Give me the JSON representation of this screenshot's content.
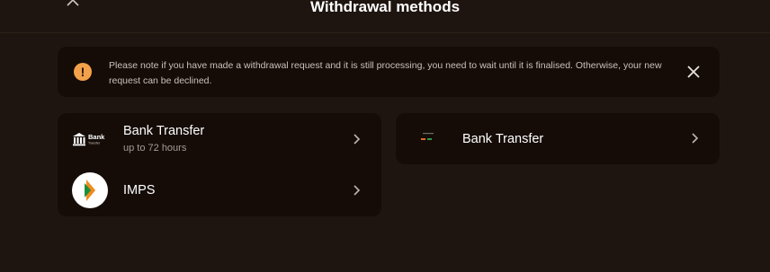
{
  "header": {
    "title": "Withdrawal methods"
  },
  "notice": {
    "text": "Please note if you have made a withdrawal request and it is still processing, you need to wait until it is finalised. Otherwise, your new request can be declined.",
    "icon_glyph": "!"
  },
  "methods_left": [
    {
      "name": "Bank Transfer",
      "subtitle": "up to 72 hours",
      "icon": "bank-building-icon"
    },
    {
      "name": "IMPS",
      "icon": "imps-icon"
    }
  ],
  "methods_right": [
    {
      "name": "Bank Transfer",
      "icon": "upi-icon"
    }
  ],
  "logos": {
    "bank_word": "Bank",
    "bank_small": "Transfer"
  },
  "colors": {
    "background": "#1f1510",
    "card": "#150c08",
    "warning": "#f2a14a",
    "text_muted": "#a49c96"
  }
}
